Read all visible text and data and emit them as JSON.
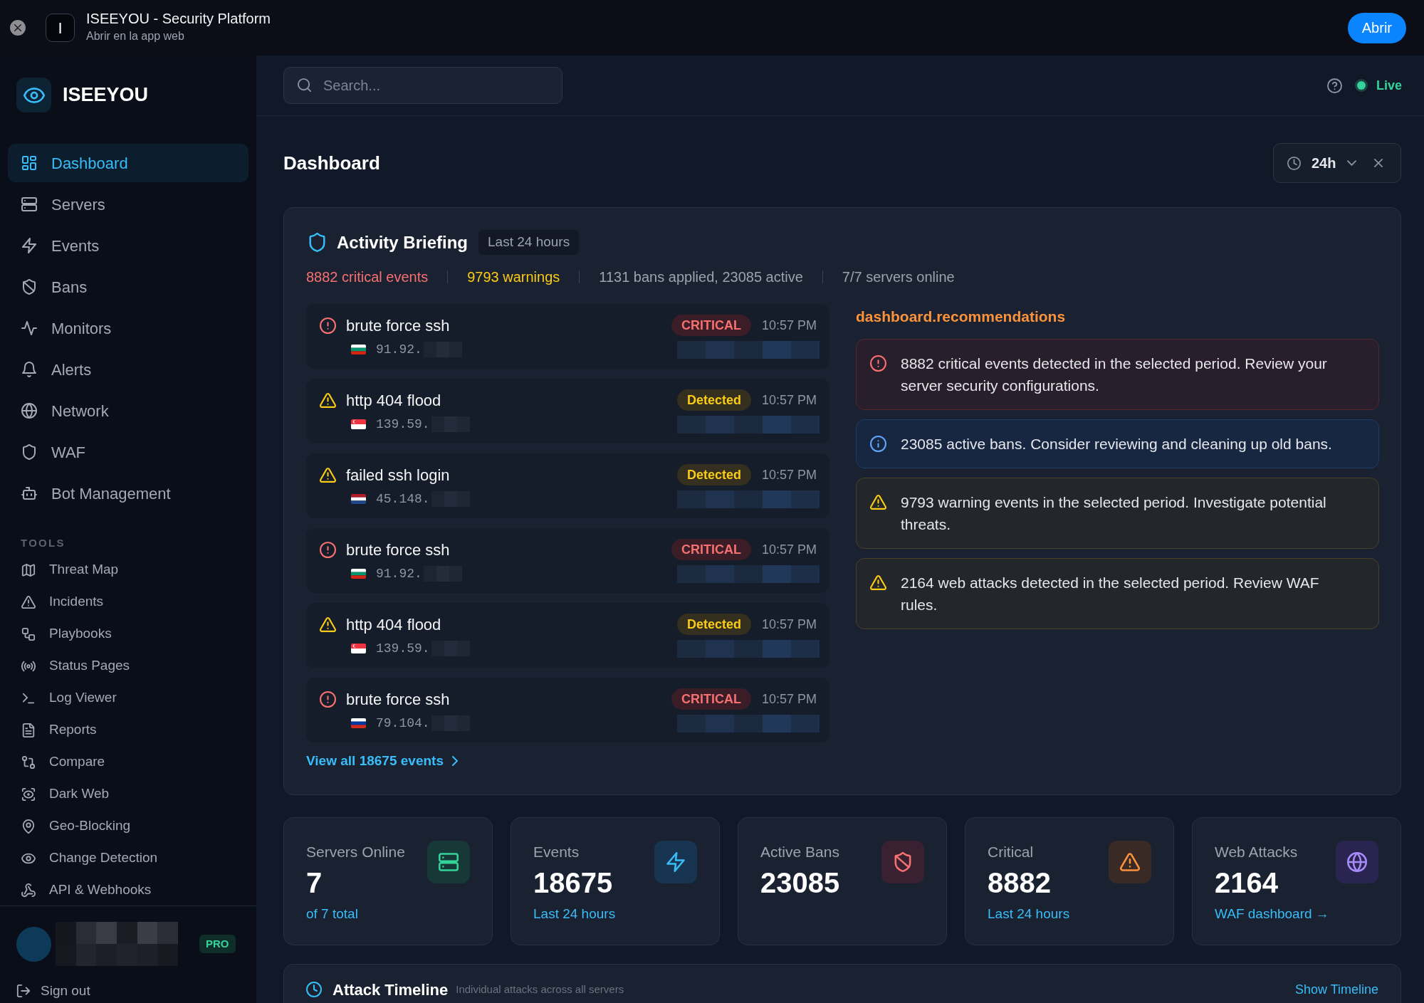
{
  "app_bar": {
    "app_icon": "I",
    "title": "ISEEYOU - Security Platform",
    "subtitle": "Abrir en la app web",
    "open_button": "Abrir"
  },
  "sidebar": {
    "brand": "ISEEYOU",
    "nav": [
      {
        "kind": "dashboard",
        "label": "Dashboard",
        "selected": true
      },
      {
        "kind": "servers",
        "label": "Servers",
        "selected": false
      },
      {
        "kind": "events",
        "label": "Events",
        "selected": false
      },
      {
        "kind": "bans",
        "label": "Bans",
        "selected": false
      },
      {
        "kind": "monitors",
        "label": "Monitors",
        "selected": false
      },
      {
        "kind": "alerts",
        "label": "Alerts",
        "selected": false
      },
      {
        "kind": "network",
        "label": "Network",
        "selected": false
      },
      {
        "kind": "waf",
        "label": "WAF",
        "selected": false
      },
      {
        "kind": "bots",
        "label": "Bot Management",
        "selected": false
      }
    ],
    "tools_heading": "TOOLS",
    "tools": [
      {
        "kind": "map",
        "label": "Threat Map",
        "selected": false
      },
      {
        "kind": "incidents",
        "label": "Incidents",
        "selected": false
      },
      {
        "kind": "playbooks",
        "label": "Playbooks",
        "selected": false
      },
      {
        "kind": "status",
        "label": "Status Pages",
        "selected": false
      },
      {
        "kind": "logs",
        "label": "Log Viewer",
        "selected": false
      },
      {
        "kind": "reports",
        "label": "Reports",
        "selected": false
      },
      {
        "kind": "compare",
        "label": "Compare",
        "selected": false
      },
      {
        "kind": "darkweb",
        "label": "Dark Web",
        "selected": false
      },
      {
        "kind": "geo",
        "label": "Geo-Blocking",
        "selected": false
      },
      {
        "kind": "changes",
        "label": "Change Detection",
        "selected": false
      },
      {
        "kind": "api",
        "label": "API & Webhooks",
        "selected": false
      }
    ],
    "user": {
      "plan_badge": "PRO"
    },
    "sign_out": "Sign out"
  },
  "header": {
    "search": {
      "placeholder": "Search..."
    },
    "status": "Live"
  },
  "page": {
    "title": "Dashboard",
    "time_range": "24h"
  },
  "briefing": {
    "title": "Activity Briefing",
    "period": "Last 24 hours",
    "summary": [
      {
        "kind": "critical",
        "text": "8882 critical events"
      },
      {
        "kind": "warning",
        "text": "9793 warnings"
      },
      {
        "kind": "neutral",
        "text": "1131 bans applied, 23085 active"
      },
      {
        "kind": "neutral",
        "text": "7/7 servers online"
      }
    ],
    "events": [
      {
        "kind": "critical",
        "title": "brute force ssh",
        "ip": "91.92.",
        "badge": "CRITICAL",
        "time": "10:57 PM"
      },
      {
        "kind": "warning",
        "title": "http 404 flood",
        "ip": "139.59.",
        "badge": "Detected",
        "time": "10:57 PM"
      },
      {
        "kind": "warning",
        "title": "failed ssh login",
        "ip": "45.148.",
        "badge": "Detected",
        "time": "10:57 PM"
      },
      {
        "kind": "critical",
        "title": "brute force ssh",
        "ip": "91.92.",
        "badge": "CRITICAL",
        "time": "10:57 PM"
      },
      {
        "kind": "warning",
        "title": "http 404 flood",
        "ip": "139.59.",
        "badge": "Detected",
        "time": "10:57 PM"
      },
      {
        "kind": "critical",
        "title": "brute force ssh",
        "ip": "79.104.",
        "badge": "CRITICAL",
        "time": "10:57 PM"
      }
    ],
    "view_all": "View all 18675 events",
    "recommendations_heading": "dashboard.recommendations",
    "recommendations": [
      {
        "kind": "critical",
        "text": "8882 critical events detected in the selected period. Review your server security configurations."
      },
      {
        "kind": "info",
        "text": "23085 active bans. Consider reviewing and cleaning up old bans."
      },
      {
        "kind": "warning",
        "text": "9793 warning events in the selected period. Investigate potential threats."
      },
      {
        "kind": "warning",
        "text": "2164 web attacks detected in the selected period. Review WAF rules."
      }
    ]
  },
  "stat_cards": [
    {
      "kind": "servers",
      "label": "Servers Online",
      "value": "7",
      "caption": "of 7 total"
    },
    {
      "kind": "events",
      "label": "Events",
      "value": "18675",
      "caption": "Last 24 hours"
    },
    {
      "kind": "bans",
      "label": "Active Bans",
      "value": "23085"
    },
    {
      "kind": "critical",
      "label": "Critical",
      "value": "8882",
      "caption": "Last 24 hours"
    },
    {
      "kind": "attacks",
      "label": "Web Attacks",
      "value": "2164",
      "caption": "WAF dashboard →"
    }
  ],
  "timeline": {
    "title": "Attack Timeline",
    "subtitle": "Individual attacks across all servers",
    "action": "Show Timeline"
  }
}
